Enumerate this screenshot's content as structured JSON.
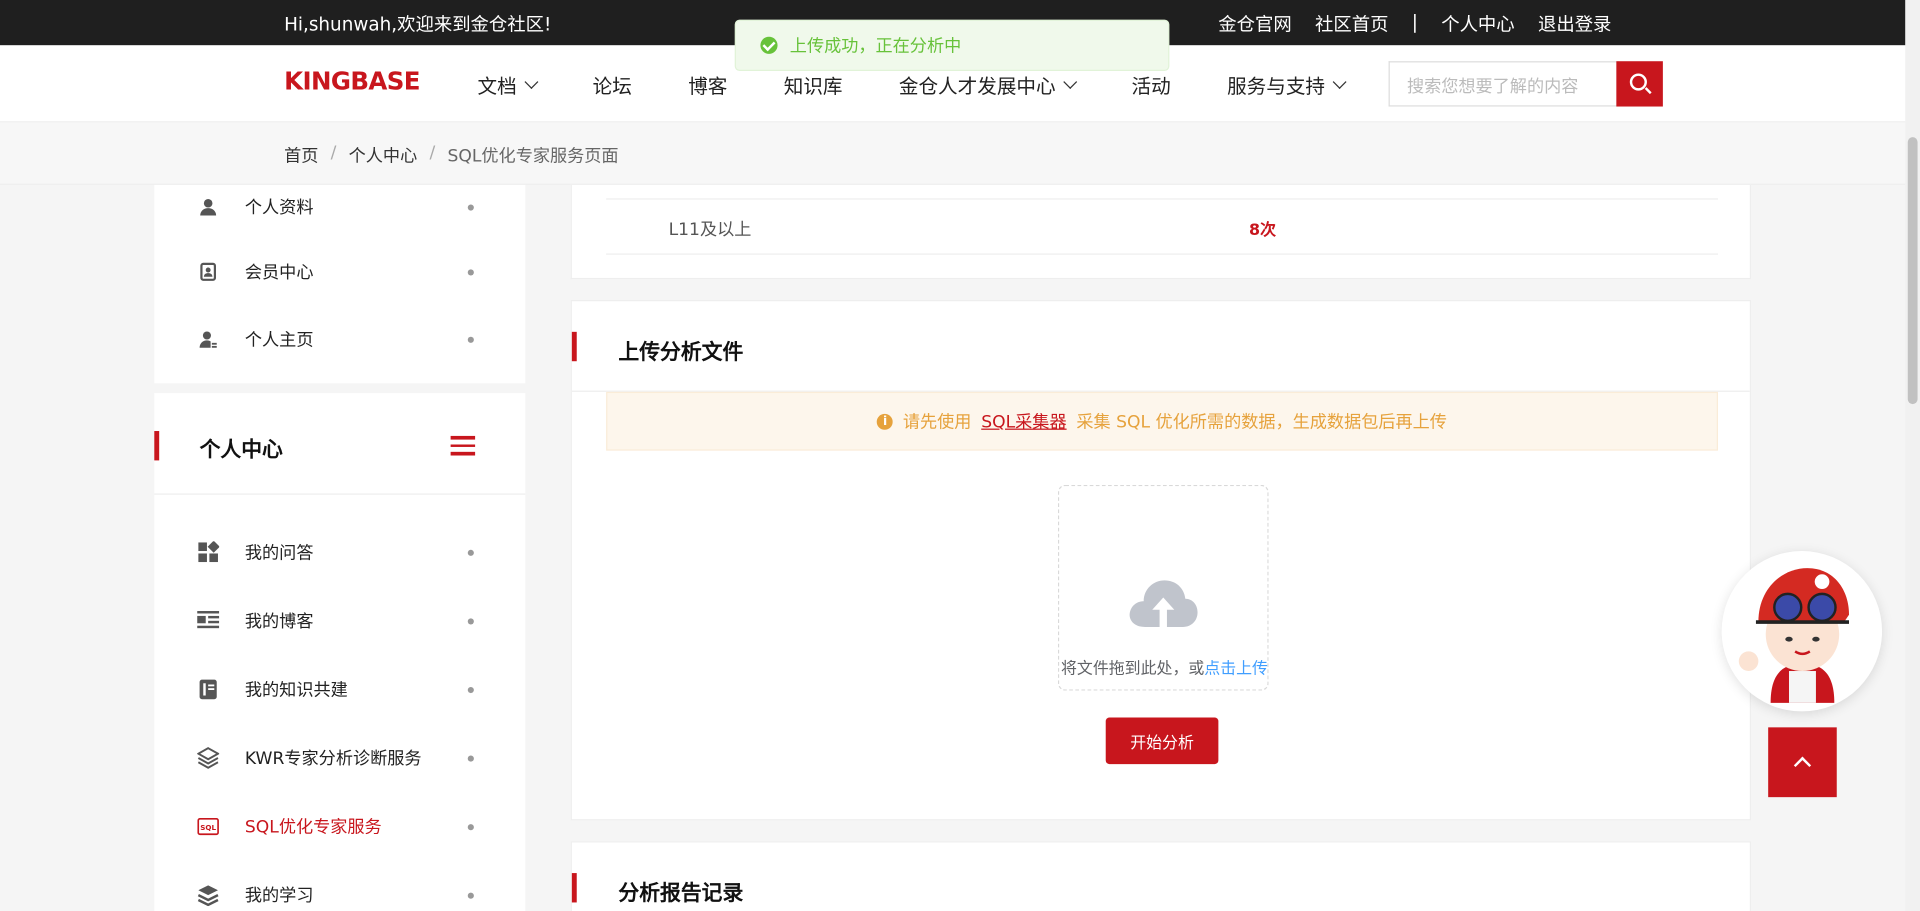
{
  "topbar": {
    "welcome": "Hi,shunwah,欢迎来到金仓社区!",
    "links": [
      "金仓官网",
      "社区首页",
      "|",
      "个人中心",
      "退出登录"
    ]
  },
  "logo": "KINGBASE",
  "nav": {
    "items": [
      {
        "label": "文档",
        "dropdown": true
      },
      {
        "label": "论坛",
        "dropdown": false
      },
      {
        "label": "博客",
        "dropdown": false
      },
      {
        "label": "知识库",
        "dropdown": false
      },
      {
        "label": "金仓人才发展中心",
        "dropdown": true
      },
      {
        "label": "活动",
        "dropdown": false
      },
      {
        "label": "服务与支持",
        "dropdown": true
      }
    ],
    "search_placeholder": "搜索您想要了解的内容"
  },
  "breadcrumb": [
    "首页",
    "个人中心",
    "SQL优化专家服务页面"
  ],
  "toast": "上传成功，正在分析中",
  "sidebar_top": [
    "个人资料",
    "会员中心",
    "个人主页"
  ],
  "sidebar": {
    "title": "个人中心",
    "items": [
      {
        "label": "我的问答",
        "icon": "grid-icon"
      },
      {
        "label": "我的博客",
        "icon": "article-icon"
      },
      {
        "label": "我的知识共建",
        "icon": "book-icon"
      },
      {
        "label": "KWR专家分析诊断服务",
        "icon": "layers-icon"
      },
      {
        "label": "SQL优化专家服务",
        "icon": "sql-icon",
        "active": true
      },
      {
        "label": "我的学习",
        "icon": "stack-icon"
      }
    ]
  },
  "quota": {
    "level": "L11及以上",
    "count": "8次"
  },
  "upload_section": {
    "title": "上传分析文件",
    "notice_before": "请先使用",
    "notice_link": "SQL采集器",
    "notice_after": "采集 SQL 优化所需的数据，生成数据包后再上传",
    "drop_text": "将文件拖到此处，或",
    "drop_link": "点击上传",
    "button": "开始分析"
  },
  "report_section": {
    "title": "分析报告记录"
  },
  "colors": {
    "brand": "#c8161d",
    "success": "#67c23a",
    "warning": "#e6a23c",
    "link": "#409eff"
  }
}
